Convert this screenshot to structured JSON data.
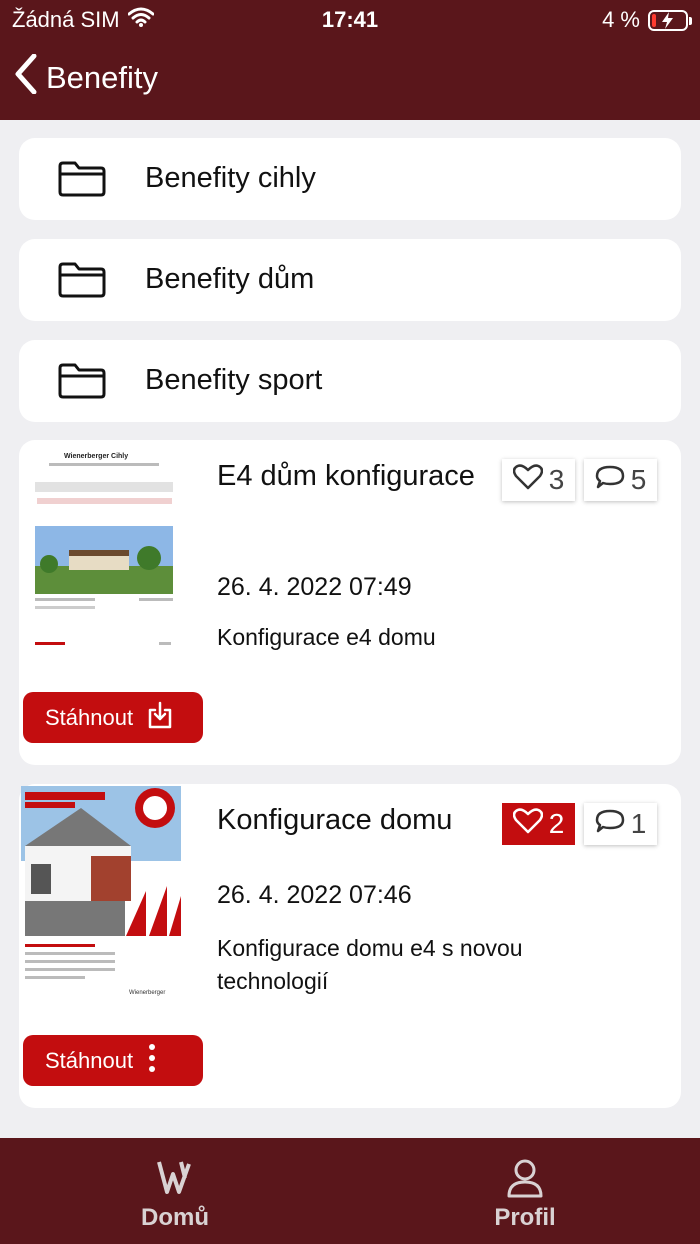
{
  "status_bar": {
    "carrier": "Žádná SIM",
    "time": "17:41",
    "battery": "4 %"
  },
  "nav": {
    "back_label": "Benefity"
  },
  "folders": [
    {
      "label": "Benefity cihly"
    },
    {
      "label": "Benefity dům"
    },
    {
      "label": "Benefity sport"
    }
  ],
  "documents": [
    {
      "title": "E4 dům konfigurace",
      "likes": "3",
      "liked": false,
      "comments": "5",
      "date": "26. 4. 2022 07:49",
      "description": "Konfigurace e4 domu",
      "download_label": "Stáhnout",
      "download_icon": "download-icon",
      "thumb_brand": "Wienerberger Cihly"
    },
    {
      "title": "Konfigurace domu",
      "likes": "2",
      "liked": true,
      "comments": "1",
      "date": "26. 4. 2022 07:46",
      "description": "Konfigurace domu e4 s novou technologií",
      "download_label": "Stáhnout",
      "download_icon": "more-vertical-icon",
      "thumb_brand": "Wienerberger"
    }
  ],
  "tab_bar": {
    "home_label": "Domů",
    "profile_label": "Profil"
  },
  "colors": {
    "brand_dark": "#5a161b",
    "accent_red": "#c30d0f",
    "background": "#efeff2"
  }
}
